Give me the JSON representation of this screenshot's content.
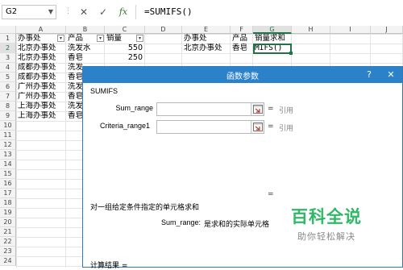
{
  "formula_bar": {
    "name_box": "G2",
    "cancel_icon": "✕",
    "enter_icon": "✓",
    "fx_label": "fx",
    "formula": "=SUMIFS()"
  },
  "columns": [
    "A",
    "B",
    "C",
    "D",
    "E",
    "F",
    "G",
    "H",
    "I",
    "J"
  ],
  "rows": [
    "1",
    "2",
    "3",
    "4",
    "5",
    "6",
    "7",
    "8",
    "9",
    "10",
    "11",
    "12",
    "13",
    "14",
    "15",
    "16",
    "17",
    "18",
    "19",
    "20",
    "21",
    "22",
    "23",
    "24"
  ],
  "sheet": {
    "headers": {
      "a1": "办事处",
      "b1": "产品",
      "c1": "销量",
      "e1": "办事处",
      "f1": "产品",
      "g1": "销量求和"
    },
    "data": [
      {
        "a": "北京办事处",
        "b": "洗发水",
        "c": "550"
      },
      {
        "a": "北京办事处",
        "b": "香皂",
        "c": "250"
      },
      {
        "a": "成都办事处",
        "b": "洗发"
      },
      {
        "a": "成都办事处",
        "b": "香皂"
      },
      {
        "a": "广州办事处",
        "b": "洗发"
      },
      {
        "a": "广州办事处",
        "b": "香皂"
      },
      {
        "a": "上海办事处",
        "b": "洗发"
      },
      {
        "a": "上海办事处",
        "b": "香皂"
      }
    ],
    "e2": "北京办事处",
    "f2": "香皂",
    "g2": "MIFS()"
  },
  "dialog": {
    "title": "函数参数",
    "help": "?",
    "close": "✕",
    "function_name": "SUMIFS",
    "args": [
      {
        "label": "Sum_range",
        "value": "引用"
      },
      {
        "label": "Criteria_range1",
        "value": "引用"
      }
    ],
    "eq": "=",
    "description": "对一组给定条件指定的单元格求和",
    "arg_desc_label": "Sum_range:",
    "arg_desc_text": "是求和的实际单元格",
    "result_label": "计算结果 ="
  },
  "watermark": {
    "big": "百科全说",
    "small": "助你轻松解决"
  }
}
